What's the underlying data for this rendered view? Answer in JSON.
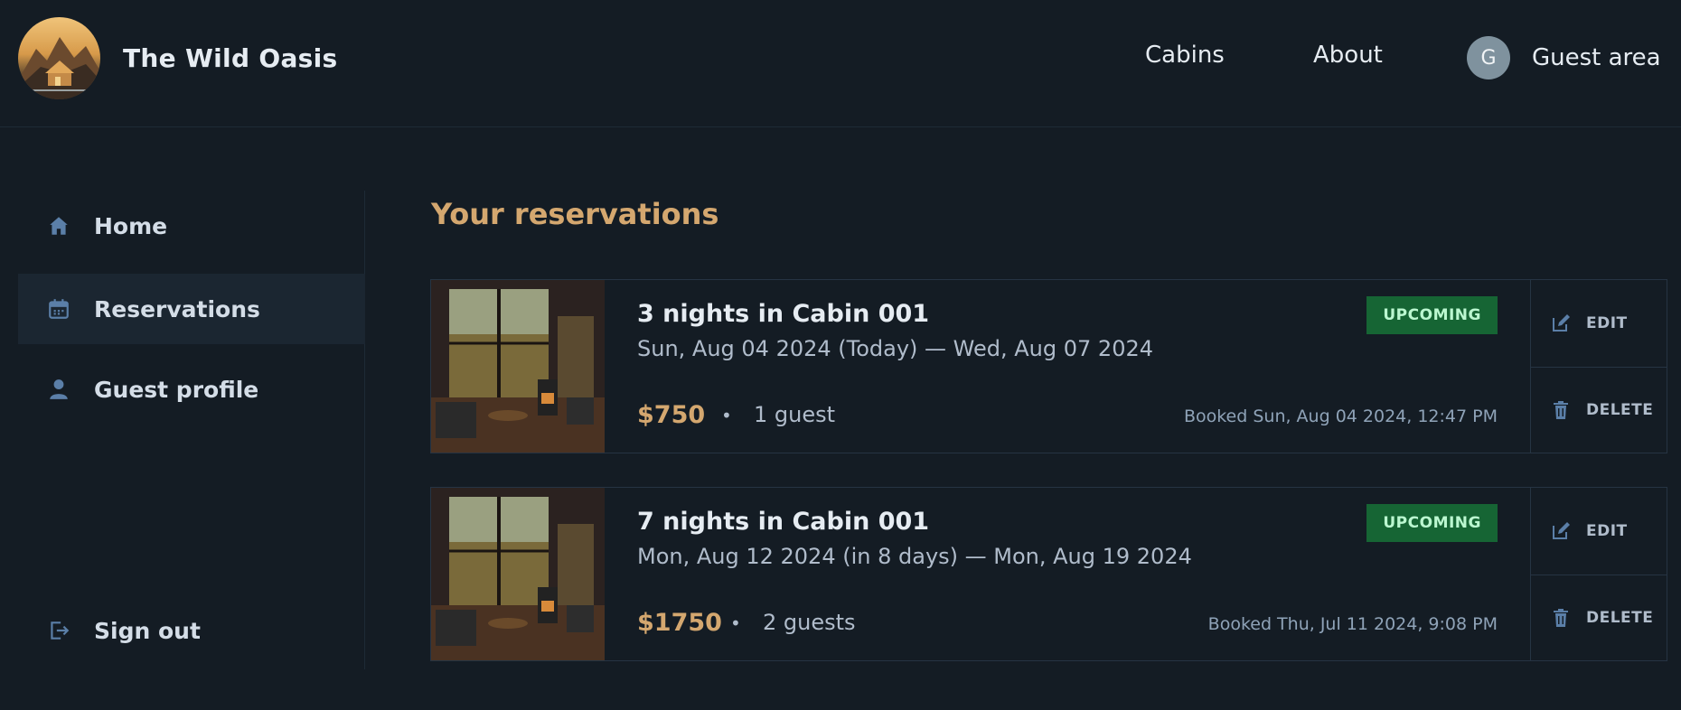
{
  "header": {
    "brand": "The Wild Oasis",
    "nav": {
      "cabins": "Cabins",
      "about": "About",
      "guest_label": "Guest area",
      "avatar_initial": "G"
    }
  },
  "sidebar": {
    "items": [
      {
        "label": "Home",
        "icon": "home-icon"
      },
      {
        "label": "Reservations",
        "icon": "calendar-icon",
        "active": true
      },
      {
        "label": "Guest profile",
        "icon": "user-icon"
      },
      {
        "label": "Sign out",
        "icon": "sign-out-icon"
      }
    ]
  },
  "main": {
    "title": "Your reservations",
    "reservations": [
      {
        "title": "3 nights in Cabin 001",
        "dates": "Sun, Aug 04 2024 (Today) — Wed, Aug 07 2024",
        "price": "$750",
        "guests": "1 guest",
        "booked": "Booked Sun, Aug 04 2024, 12:47 PM",
        "status": "UPCOMING",
        "edit_label": "EDIT",
        "delete_label": "DELETE"
      },
      {
        "title": "7 nights in Cabin 001",
        "dates": "Mon, Aug 12 2024 (in 8 days) — Mon, Aug 19 2024",
        "price": "$1750",
        "guests": "2 guests",
        "booked": "Booked Thu, Jul 11 2024, 9:08 PM",
        "status": "UPCOMING",
        "edit_label": "EDIT",
        "delete_label": "DELETE"
      }
    ]
  },
  "colors": {
    "background": "#141c24",
    "accent": "#d4a76f",
    "badge_bg": "#166534",
    "badge_text": "#bbf7d0",
    "sidebar_active": "#1b2631"
  }
}
